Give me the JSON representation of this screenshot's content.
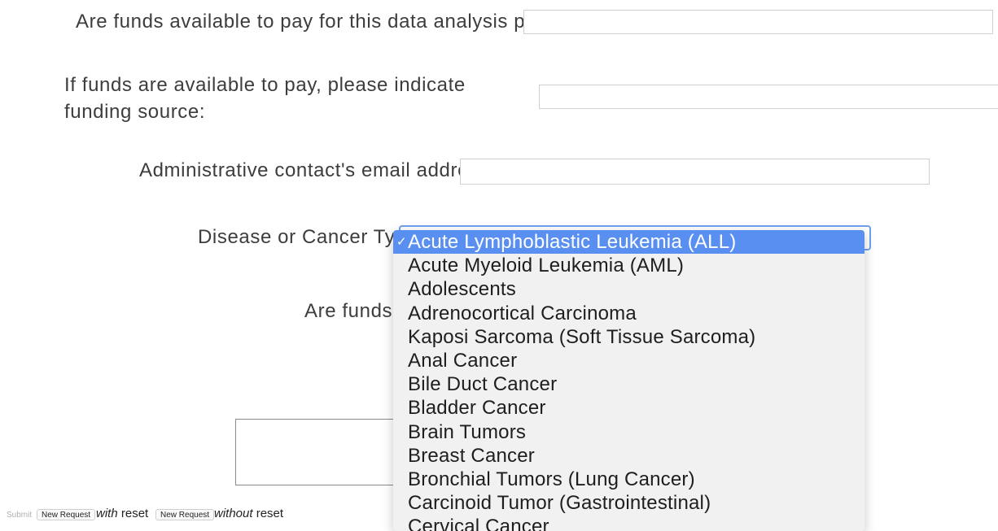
{
  "questions": {
    "funds_question": "Are funds available to pay for this data analysis project?",
    "funding_source_label": "If funds are available to pay, please indicate funding source:",
    "admin_email_label": "Administrative contact's email address*",
    "disease_label": "Disease or Cancer Types",
    "partial_question": "Are funds a"
  },
  "disease_select": {
    "selected": "Acute Lymphoblastic Leukemia (ALL)",
    "checkmark": "✓",
    "options": [
      "Acute Lymphoblastic Leukemia (ALL)",
      "Acute Myeloid Leukemia (AML)",
      "Adolescents",
      "Adrenocortical Carcinoma",
      "Kaposi Sarcoma (Soft Tissue Sarcoma)",
      "Anal Cancer",
      "Bile Duct Cancer",
      "Bladder Cancer",
      "Brain Tumors",
      "Breast Cancer",
      "Bronchial Tumors (Lung Cancer)",
      "Carcinoid Tumor (Gastrointestinal)",
      "Cervical Cancer"
    ]
  },
  "footer": {
    "submit_label": "Submit",
    "new_request_label": "New Request",
    "with_text": "with",
    "reset_text": "reset",
    "without_text": "without"
  }
}
